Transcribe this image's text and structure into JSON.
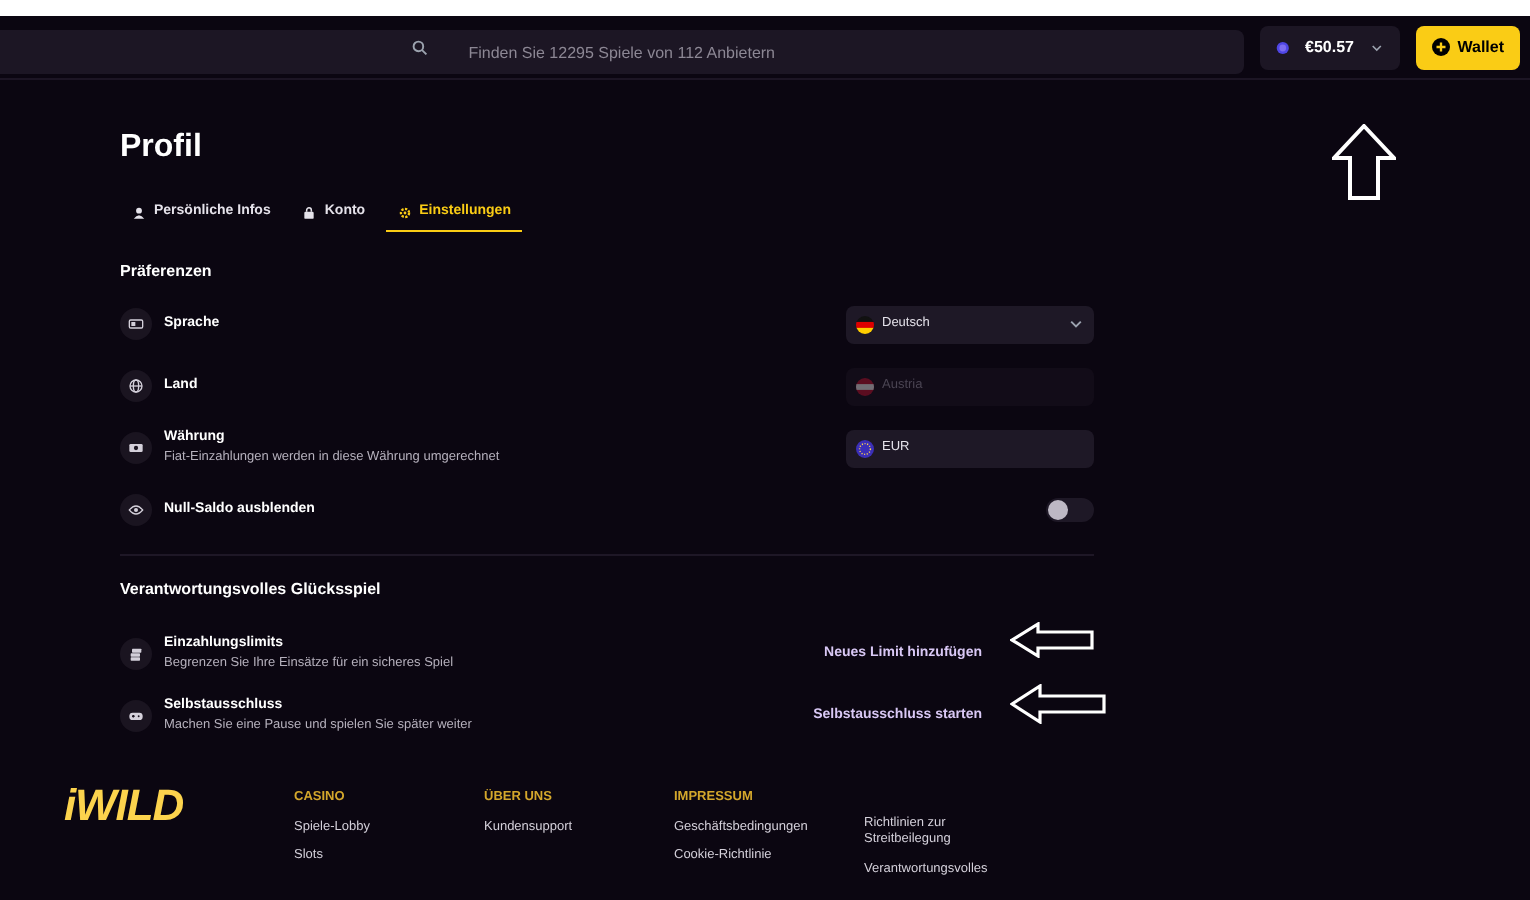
{
  "header": {
    "search": {
      "placeholder": "Finden Sie 12295 Spiele von 112 Anbietern"
    },
    "balance": "€50.57",
    "wallet_button": "Wallet"
  },
  "page": {
    "title": "Profil",
    "tabs": [
      {
        "label": "Persönliche Infos",
        "selected": false
      },
      {
        "label": "Konto",
        "selected": false
      },
      {
        "label": "Einstellungen",
        "selected": true
      }
    ],
    "preferences": {
      "title": "Präferenzen",
      "rows": [
        {
          "kind": "select",
          "label": "Sprache",
          "value": "Deutsch",
          "disabled": false,
          "dropdown": true
        },
        {
          "kind": "select",
          "label": "Land",
          "value": "Austria",
          "disabled": true,
          "dropdown": false
        },
        {
          "kind": "select",
          "label": "Währung",
          "description": "Fiat-Einzahlungen werden in diese Währung umgerechnet",
          "value": "EUR",
          "disabled": false,
          "dropdown": false
        },
        {
          "kind": "toggle",
          "label": "Null-Saldo ausblenden",
          "on": false
        }
      ]
    },
    "responsible": {
      "title": "Verantwortungsvolles Glücksspiel",
      "rows": [
        {
          "label": "Einzahlungslimits",
          "description": "Begrenzen Sie Ihre Einsätze für ein sicheres Spiel",
          "action": "Neues Limit hinzufügen"
        },
        {
          "label": "Selbstausschluss",
          "description": "Machen Sie eine Pause und spielen Sie später weiter",
          "action": "Selbstausschluss starten"
        }
      ]
    }
  },
  "footer": {
    "logo": "iWILD",
    "columns": [
      {
        "heading": "CASINO",
        "links": [
          "Spiele-Lobby",
          "Slots"
        ]
      },
      {
        "heading": "ÜBER UNS",
        "links": [
          "Kundensupport"
        ]
      },
      {
        "heading": "IMPRESSUM",
        "links": [
          "Geschäftsbedingungen",
          "Cookie-Richtlinie"
        ]
      },
      {
        "links": [
          "Richtlinien zur Streitbeilegung",
          "Verantwortungsvolles"
        ]
      }
    ]
  }
}
